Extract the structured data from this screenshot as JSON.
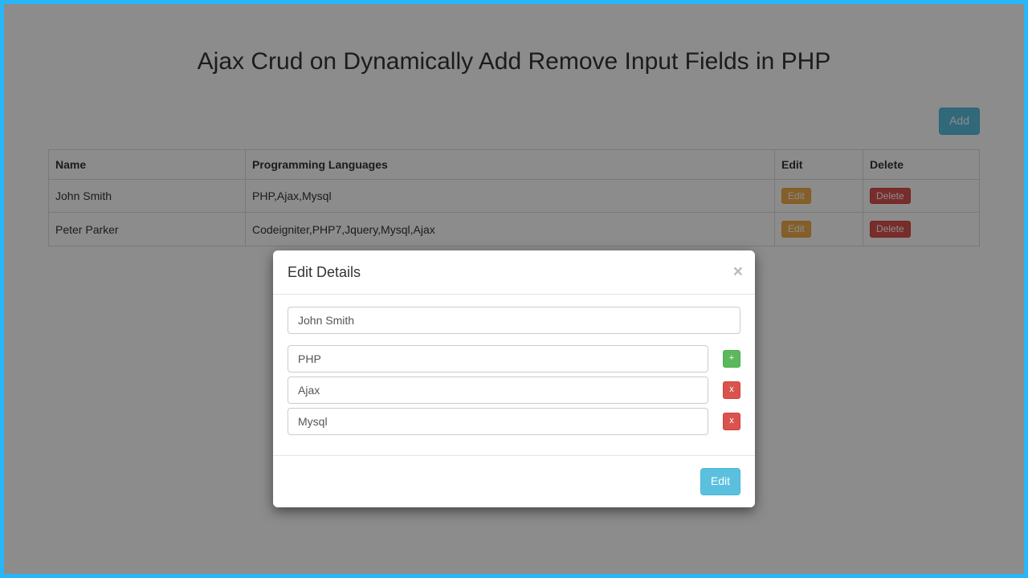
{
  "page_title": "Ajax Crud on Dynamically Add Remove Input Fields in PHP",
  "add_button": "Add",
  "table": {
    "headers": {
      "name": "Name",
      "lang": "Programming Languages",
      "edit": "Edit",
      "delete": "Delete"
    },
    "rows": [
      {
        "name": "John Smith",
        "lang": "PHP,Ajax,Mysql",
        "edit": "Edit",
        "delete": "Delete"
      },
      {
        "name": "Peter Parker",
        "lang": "Codeigniter,PHP7,Jquery,Mysql,Ajax",
        "edit": "Edit",
        "delete": "Delete"
      }
    ]
  },
  "modal": {
    "title": "Edit Details",
    "close": "×",
    "name_value": "John Smith",
    "fields": [
      {
        "value": "PHP",
        "action": "add",
        "glyph": "+"
      },
      {
        "value": "Ajax",
        "action": "remove",
        "glyph": "x"
      },
      {
        "value": "Mysql",
        "action": "remove",
        "glyph": "x"
      }
    ],
    "submit": "Edit"
  }
}
